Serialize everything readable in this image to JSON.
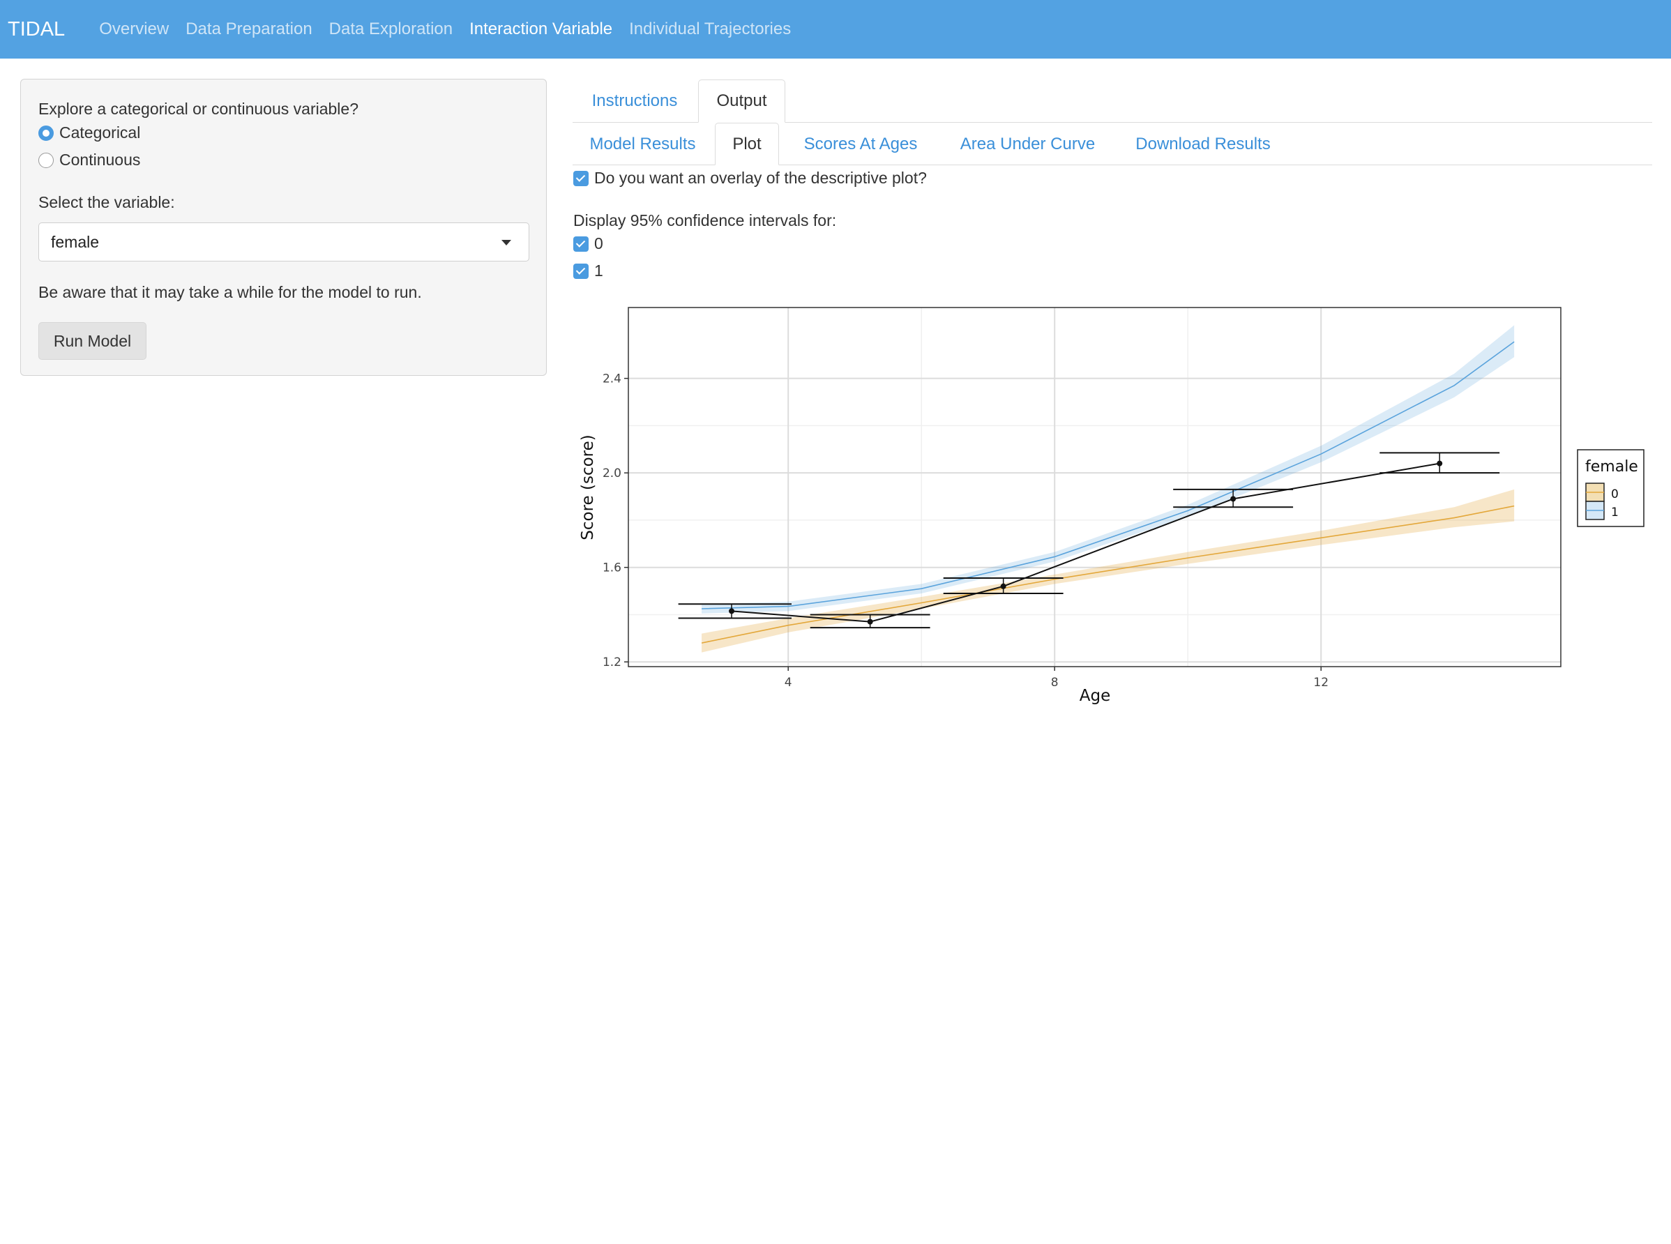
{
  "navbar": {
    "brand": "TIDAL",
    "links": [
      "Overview",
      "Data Preparation",
      "Data Exploration",
      "Interaction Variable",
      "Individual Trajectories"
    ],
    "active": "Interaction Variable"
  },
  "sidebar": {
    "question": "Explore a categorical or continuous variable?",
    "options": [
      "Categorical",
      "Continuous"
    ],
    "selected_option": "Categorical",
    "select_label": "Select the variable:",
    "select_value": "female",
    "note": "Be aware that it may take a while for the model to run.",
    "run_button": "Run Model"
  },
  "main_tabs": {
    "items": [
      "Instructions",
      "Output"
    ],
    "active": "Output"
  },
  "sub_tabs": {
    "items": [
      "Model Results",
      "Plot",
      "Scores At Ages",
      "Area Under Curve",
      "Download Results"
    ],
    "active": "Plot"
  },
  "overlay": {
    "label": "Do you want an overlay of the descriptive plot?",
    "checked": true
  },
  "ci": {
    "label": "Display 95% confidence intervals for:",
    "options": [
      {
        "label": "0",
        "checked": true
      },
      {
        "label": "1",
        "checked": true
      }
    ]
  },
  "colors": {
    "accent": "#53a2e2",
    "series0": "#e3a73a",
    "series1": "#5aa3dc",
    "descriptive": "#000000"
  },
  "chart_data": {
    "type": "line",
    "xlabel": "Age",
    "ylabel": "Score (score)",
    "xlim": [
      1.6,
      15.6
    ],
    "ylim": [
      1.18,
      2.7
    ],
    "xticks": [
      4,
      8,
      12
    ],
    "yticks": [
      1.2,
      1.6,
      2.0,
      2.4
    ],
    "grid": true,
    "legend": {
      "title": "female",
      "position": "right",
      "entries": [
        "0",
        "1"
      ]
    },
    "series": [
      {
        "name": "0",
        "x": [
          2.7,
          4,
          6,
          8,
          10,
          12,
          14,
          14.9
        ],
        "y": [
          1.28,
          1.355,
          1.45,
          1.55,
          1.64,
          1.725,
          1.81,
          1.86
        ],
        "ci_lower": [
          1.24,
          1.325,
          1.425,
          1.53,
          1.615,
          1.695,
          1.77,
          1.795
        ],
        "ci_upper": [
          1.32,
          1.385,
          1.475,
          1.57,
          1.665,
          1.755,
          1.855,
          1.93
        ]
      },
      {
        "name": "1",
        "x": [
          2.7,
          4,
          6,
          8,
          10,
          12,
          14,
          14.9
        ],
        "y": [
          1.425,
          1.435,
          1.51,
          1.645,
          1.84,
          2.08,
          2.37,
          2.555
        ],
        "ci_lower": [
          1.405,
          1.415,
          1.49,
          1.625,
          1.815,
          2.045,
          2.32,
          2.49
        ],
        "ci_upper": [
          1.445,
          1.455,
          1.53,
          1.665,
          1.865,
          2.115,
          2.42,
          2.625
        ]
      }
    ],
    "descriptive": {
      "x": [
        3.15,
        5.23,
        7.23,
        10.68,
        13.78
      ],
      "y": [
        1.415,
        1.37,
        1.52,
        1.89,
        2.04
      ],
      "y_lower": [
        1.385,
        1.345,
        1.49,
        1.855,
        2.0
      ],
      "y_upper": [
        1.445,
        1.4,
        1.555,
        1.93,
        2.085
      ],
      "x_lower": [
        2.35,
        4.33,
        6.33,
        9.78,
        12.88
      ],
      "x_upper": [
        4.05,
        6.13,
        8.13,
        11.58,
        14.68
      ]
    }
  }
}
